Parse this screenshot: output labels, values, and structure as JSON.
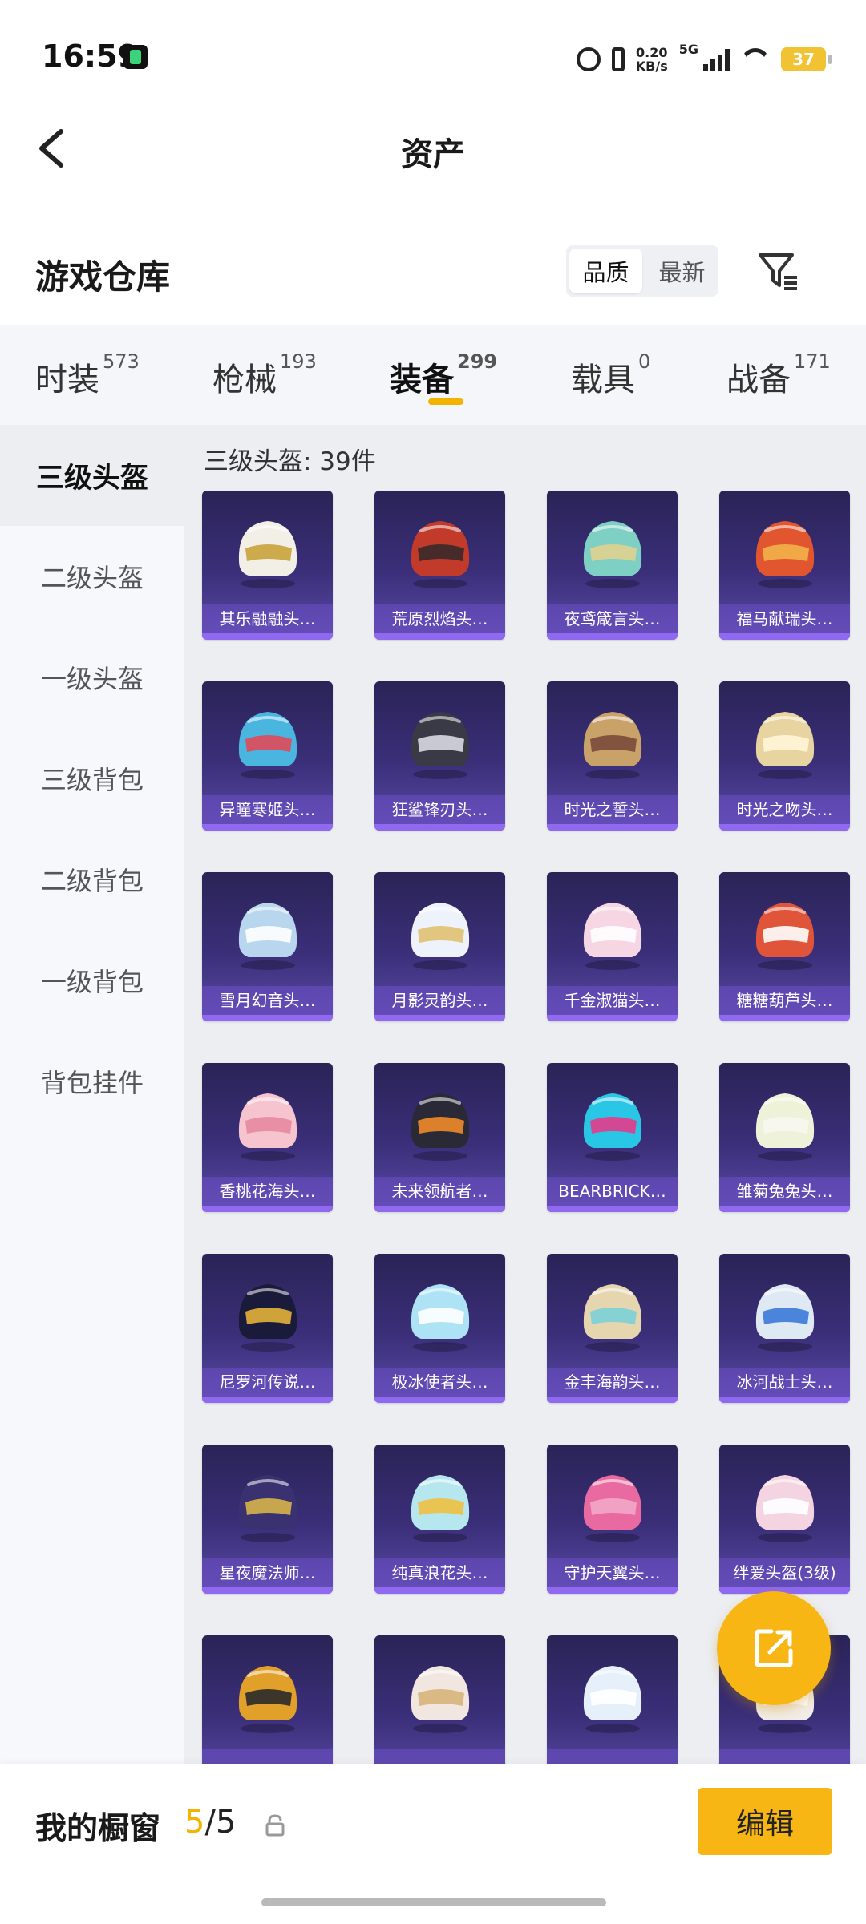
{
  "status_bar": {
    "time": "16:59",
    "speed_top": "0.20",
    "speed_bottom": "KB/s",
    "network": "5G",
    "battery": "37"
  },
  "header": {
    "title": "资产"
  },
  "warehouse": {
    "title": "游戏仓库",
    "sort_options": [
      "品质",
      "最新"
    ],
    "active_sort": "品质"
  },
  "tabs": [
    {
      "label": "时装",
      "count": "573"
    },
    {
      "label": "枪械",
      "count": "193"
    },
    {
      "label": "装备",
      "count": "299",
      "active": true
    },
    {
      "label": "载具",
      "count": "0"
    },
    {
      "label": "战备",
      "count": "171"
    }
  ],
  "side_nav": [
    "三级头盔",
    "二级头盔",
    "一级头盔",
    "三级背包",
    "二级背包",
    "一级背包",
    "背包挂件"
  ],
  "section_title": "三级头盔: 39件",
  "items": [
    {
      "label": "其乐融融头…",
      "color": "#f2efe6",
      "accent": "#c9a23a"
    },
    {
      "label": "荒原烈焰头…",
      "color": "#c23a2a",
      "accent": "#3a2a2a"
    },
    {
      "label": "夜鸢箴言头…",
      "color": "#7fd0c4",
      "accent": "#e0d090"
    },
    {
      "label": "福马献瑞头…",
      "color": "#e2562f",
      "accent": "#f3b34a"
    },
    {
      "label": "异瞳寒姬头…",
      "color": "#4ab6e0",
      "accent": "#e14a5a"
    },
    {
      "label": "狂鲨锋刃头…",
      "color": "#3a3a46",
      "accent": "#d9d9e0"
    },
    {
      "label": "时光之誓头…",
      "color": "#c9a26a",
      "accent": "#7a4a3a"
    },
    {
      "label": "时光之吻头…",
      "color": "#e8d4a0",
      "accent": "#fff6d8"
    },
    {
      "label": "雪月幻音头…",
      "color": "#b8d6ee",
      "accent": "#ffffff"
    },
    {
      "label": "月影灵韵头…",
      "color": "#eef2fa",
      "accent": "#e0c070"
    },
    {
      "label": "千金淑猫头…",
      "color": "#f7d6e4",
      "accent": "#ffffff"
    },
    {
      "label": "糖糖葫芦头…",
      "color": "#e0553a",
      "accent": "#ffffff"
    },
    {
      "label": "香桃花海头…",
      "color": "#f5c4cf",
      "accent": "#e88aa0"
    },
    {
      "label": "未来领航者…",
      "color": "#2a2a36",
      "accent": "#f08a2a"
    },
    {
      "label": "BEARBRICK…",
      "color": "#2ac6e6",
      "accent": "#e63a8a"
    },
    {
      "label": "雏菊兔兔头…",
      "color": "#eef2d8",
      "accent": "#f7f7f0"
    },
    {
      "label": "尼罗河传说…",
      "color": "#1a1a3a",
      "accent": "#e3b23a"
    },
    {
      "label": "极冰使者头…",
      "color": "#aee2f5",
      "accent": "#ffffff"
    },
    {
      "label": "金丰海韵头…",
      "color": "#e6d6b0",
      "accent": "#7ad0d8"
    },
    {
      "label": "冰河战士头…",
      "color": "#dfe9f3",
      "accent": "#3a7ad8"
    },
    {
      "label": "星夜魔法师…",
      "color": "#3a3270",
      "accent": "#d8b24a"
    },
    {
      "label": "纯真浪花头…",
      "color": "#b6e6ee",
      "accent": "#f0c040"
    },
    {
      "label": "守护天翼头…",
      "color": "#e86aa0",
      "accent": "#f2a8c8"
    },
    {
      "label": "绊爱头盔(3级)",
      "color": "#f4d4e0",
      "accent": "#ffffff"
    },
    {
      "label": "",
      "color": "#e0a02a",
      "accent": "#2a2a2a"
    },
    {
      "label": "",
      "color": "#f2e6e0",
      "accent": "#d8b47a"
    },
    {
      "label": "",
      "color": "#e6f0fa",
      "accent": "#ffffff"
    },
    {
      "label": "",
      "color": "#f2ece6",
      "accent": "#ffffff"
    }
  ],
  "bottom": {
    "label": "我的橱窗",
    "used": "5",
    "sep": "/",
    "total": "5",
    "edit_label": "编辑"
  },
  "colors": {
    "accent": "#f7b613",
    "tab_bg": "#f4f6f9",
    "grid_bg": "#eceef2"
  },
  "icons": [
    "back-icon",
    "filter-icon",
    "share-icon",
    "lock-icon",
    "alarm-icon",
    "vibrate-icon",
    "signal-icon",
    "wifi-icon",
    "battery-icon"
  ]
}
